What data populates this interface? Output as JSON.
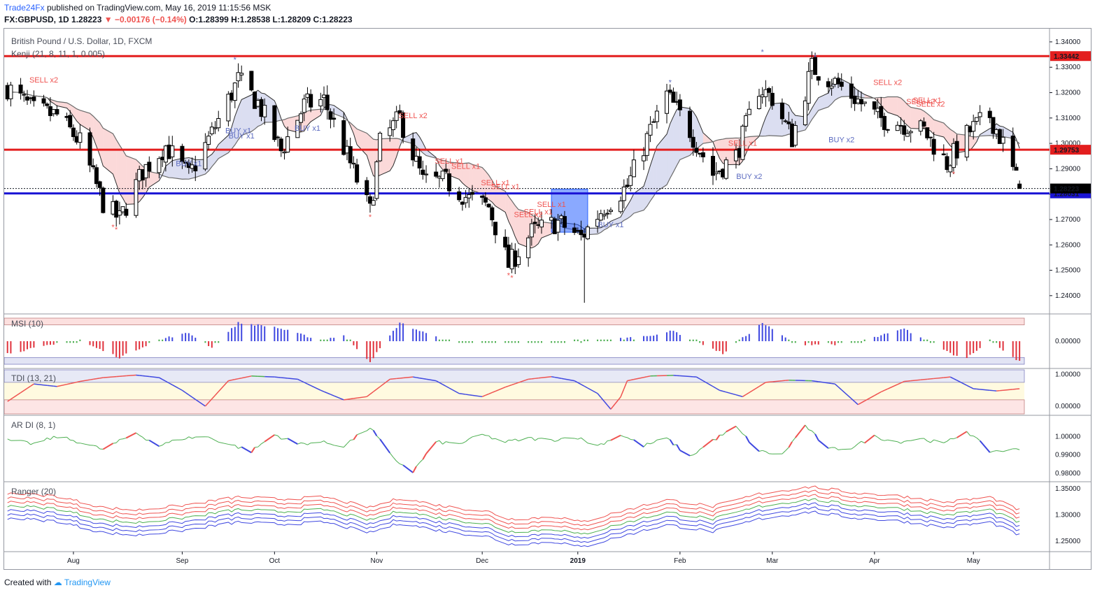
{
  "header": {
    "brand": "Trade24Fx",
    "published": "published on TradingView.com, May 16, 2019 11:15:56 MSK",
    "symbol": "FX:GBPUSD, 1D",
    "last": "1.28223",
    "change": "−0.00176 (−0.14%)",
    "ohlc": "O:1.28399 H:1.28538 L:1.28209 C:1.28223"
  },
  "footer": {
    "created": "Created with",
    "tv": "TradingView"
  },
  "colors": {
    "up": "#ffffff",
    "down": "#000000",
    "red_line": "#e31e1e",
    "blue_line": "#1a14d4",
    "sell": "#ef5350",
    "buy": "#5c6bc0",
    "msi_pos": "#3f48e0",
    "msi_neg": "#e0323c",
    "msi_flat": "#4caf50"
  },
  "chart_data": [
    {
      "type": "candlestick",
      "title": "British Pound / U.S. Dollar, 1D, FXCM",
      "indicator": "Kenji (21, 8, 11, 1, 0.005)",
      "ylim": [
        1.235,
        1.343
      ],
      "y_ticks": [
        "1.34000",
        "1.33000",
        "1.32000",
        "1.31000",
        "1.30000",
        "1.29000",
        "1.28000",
        "1.27000",
        "1.26000",
        "1.25000",
        "1.24000"
      ],
      "x_ticks": [
        "Aug",
        "Sep",
        "Oct",
        "Nov",
        "Dec",
        "2019",
        "Feb",
        "Mar",
        "Apr",
        "May"
      ],
      "horizontal_lines": [
        {
          "value": 1.3344,
          "label": "1.33442",
          "color": "red"
        },
        {
          "value": 1.2975,
          "label": "1.29753",
          "color": "red"
        },
        {
          "value": 1.2803,
          "label": "1.28031",
          "color": "blue"
        }
      ],
      "last_price": {
        "value": 1.28223,
        "label": "1.28223"
      },
      "close_path": [
        [
          "2018-07-12",
          1.322
        ],
        [
          "2018-07-20",
          1.313
        ],
        [
          "2018-07-27",
          1.311
        ],
        [
          "2018-08-03",
          1.3005
        ],
        [
          "2018-08-10",
          1.2765
        ],
        [
          "2018-08-15",
          1.27
        ],
        [
          "2018-08-22",
          1.289
        ],
        [
          "2018-08-29",
          1.299
        ],
        [
          "2018-09-05",
          1.287
        ],
        [
          "2018-09-12",
          1.304
        ],
        [
          "2018-09-20",
          1.325
        ],
        [
          "2018-09-26",
          1.316
        ],
        [
          "2018-10-03",
          1.297
        ],
        [
          "2018-10-10",
          1.315
        ],
        [
          "2018-10-16",
          1.317
        ],
        [
          "2018-10-24",
          1.292
        ],
        [
          "2018-10-30",
          1.273
        ],
        [
          "2018-11-02",
          1.3
        ],
        [
          "2018-11-08",
          1.31
        ],
        [
          "2018-11-15",
          1.285
        ],
        [
          "2018-11-22",
          1.285
        ],
        [
          "2018-11-29",
          1.278
        ],
        [
          "2018-12-05",
          1.275
        ],
        [
          "2018-12-11",
          1.252
        ],
        [
          "2018-12-18",
          1.265
        ],
        [
          "2018-12-26",
          1.269
        ],
        [
          "2019-01-02",
          1.263
        ],
        [
          "2019-01-09",
          1.275
        ],
        [
          "2019-01-16",
          1.283
        ],
        [
          "2019-01-23",
          1.305
        ],
        [
          "2019-01-28",
          1.319
        ],
        [
          "2019-02-04",
          1.305
        ],
        [
          "2019-02-11",
          1.288
        ],
        [
          "2019-02-18",
          1.295
        ],
        [
          "2019-02-25",
          1.322
        ],
        [
          "2019-03-01",
          1.318
        ],
        [
          "2019-03-07",
          1.302
        ],
        [
          "2019-03-13",
          1.33
        ],
        [
          "2019-03-20",
          1.324
        ],
        [
          "2019-03-26",
          1.318
        ],
        [
          "2019-04-02",
          1.31
        ],
        [
          "2019-04-09",
          1.308
        ],
        [
          "2019-04-16",
          1.305
        ],
        [
          "2019-04-23",
          1.292
        ],
        [
          "2019-04-30",
          1.305
        ],
        [
          "2019-05-06",
          1.311
        ],
        [
          "2019-05-10",
          1.3
        ],
        [
          "2019-05-15",
          1.2822
        ]
      ],
      "signals": [
        {
          "date": "2018-07-23",
          "text": "SELL x2",
          "side": "sell",
          "price": 1.324
        },
        {
          "date": "2018-09-05",
          "text": "BUY x1",
          "side": "buy",
          "price": 1.291
        },
        {
          "date": "2018-09-20",
          "text": "BUY x1",
          "side": "buy",
          "price": 1.304
        },
        {
          "date": "2018-09-21",
          "text": "BUY x1",
          "side": "buy",
          "price": 1.302
        },
        {
          "date": "2018-10-11",
          "text": "BUY x1",
          "side": "buy",
          "price": 1.305
        },
        {
          "date": "2018-11-12",
          "text": "SELL x2",
          "side": "sell",
          "price": 1.31
        },
        {
          "date": "2018-11-23",
          "text": "SELL x1",
          "side": "sell",
          "price": 1.292
        },
        {
          "date": "2018-11-28",
          "text": "SELL x1",
          "side": "sell",
          "price": 1.29
        },
        {
          "date": "2018-12-07",
          "text": "SELL x1",
          "side": "sell",
          "price": 1.2835
        },
        {
          "date": "2018-12-10",
          "text": "SELL x1",
          "side": "sell",
          "price": 1.282
        },
        {
          "date": "2018-12-17",
          "text": "SELL x2",
          "side": "sell",
          "price": 1.271
        },
        {
          "date": "2018-12-20",
          "text": "SELL x1",
          "side": "sell",
          "price": 1.272
        },
        {
          "date": "2018-12-24",
          "text": "SELL x1",
          "side": "sell",
          "price": 1.275
        },
        {
          "date": "2019-01-11",
          "text": "BUY x1",
          "side": "buy",
          "price": 1.267
        },
        {
          "date": "2019-02-20",
          "text": "SELL x1",
          "side": "sell",
          "price": 1.299
        },
        {
          "date": "2019-02-22",
          "text": "BUY x2",
          "side": "buy",
          "price": 1.286
        },
        {
          "date": "2019-03-22",
          "text": "BUY x2",
          "side": "buy",
          "price": 1.3005
        },
        {
          "date": "2019-04-05",
          "text": "SELL x2",
          "side": "sell",
          "price": 1.323
        },
        {
          "date": "2019-04-15",
          "text": "SELL x2",
          "side": "sell",
          "price": 1.3155
        },
        {
          "date": "2019-04-17",
          "text": "SELL x1",
          "side": "sell",
          "price": 1.316
        },
        {
          "date": "2019-04-18",
          "text": "SELL x2",
          "side": "sell",
          "price": 1.3145
        }
      ]
    },
    {
      "type": "bar",
      "title": "MSI (10)",
      "ylim": [
        -1.2,
        1.2
      ],
      "y_ticks": [
        "0.00000"
      ],
      "bands": [
        0.8,
        -0.8
      ]
    },
    {
      "type": "line",
      "title": "TDI (13, 21)",
      "ylim": [
        -0.2,
        1.1
      ],
      "y_ticks": [
        "1.00000",
        "0.00000"
      ],
      "bands": [
        0.75,
        0.2
      ],
      "points": [
        [
          "2018-07-12",
          0.15
        ],
        [
          "2018-07-20",
          0.7
        ],
        [
          "2018-07-27",
          0.62
        ],
        [
          "2018-08-03",
          0.78
        ],
        [
          "2018-08-10",
          0.9
        ],
        [
          "2018-08-20",
          0.98
        ],
        [
          "2018-08-27",
          0.9
        ],
        [
          "2018-09-03",
          0.5
        ],
        [
          "2018-09-10",
          0.0
        ],
        [
          "2018-09-17",
          0.8
        ],
        [
          "2018-09-24",
          0.95
        ],
        [
          "2018-10-01",
          0.92
        ],
        [
          "2018-10-08",
          0.85
        ],
        [
          "2018-10-15",
          0.5
        ],
        [
          "2018-10-22",
          0.2
        ],
        [
          "2018-10-29",
          0.3
        ],
        [
          "2018-11-05",
          0.85
        ],
        [
          "2018-11-12",
          0.92
        ],
        [
          "2018-11-19",
          0.8
        ],
        [
          "2018-11-26",
          0.4
        ],
        [
          "2018-12-03",
          0.3
        ],
        [
          "2018-12-10",
          0.6
        ],
        [
          "2018-12-17",
          0.85
        ],
        [
          "2018-12-24",
          0.93
        ],
        [
          "2018-12-31",
          0.8
        ],
        [
          "2019-01-07",
          0.4
        ],
        [
          "2019-01-12",
          -0.22
        ],
        [
          "2019-01-16",
          0.8
        ],
        [
          "2019-01-23",
          0.95
        ],
        [
          "2019-01-30",
          0.97
        ],
        [
          "2019-02-06",
          0.92
        ],
        [
          "2019-02-13",
          0.5
        ],
        [
          "2019-02-20",
          0.3
        ],
        [
          "2019-02-27",
          0.75
        ],
        [
          "2019-03-06",
          0.82
        ],
        [
          "2019-03-13",
          0.8
        ],
        [
          "2019-03-20",
          0.7
        ],
        [
          "2019-03-27",
          0.05
        ],
        [
          "2019-04-03",
          0.45
        ],
        [
          "2019-04-10",
          0.78
        ],
        [
          "2019-04-17",
          0.85
        ],
        [
          "2019-04-24",
          0.92
        ],
        [
          "2019-05-01",
          0.55
        ],
        [
          "2019-05-08",
          0.48
        ],
        [
          "2019-05-15",
          0.55
        ]
      ]
    },
    {
      "type": "line",
      "title": "AR DI (8, 1)",
      "ylim": [
        0.977,
        1.01
      ],
      "y_ticks": [
        "1.00000",
        "0.99000",
        "0.98000"
      ],
      "points": [
        [
          "2018-07-12",
          0.998
        ],
        [
          "2018-07-20",
          0.996
        ],
        [
          "2018-07-27",
          1.0
        ],
        [
          "2018-08-03",
          0.997
        ],
        [
          "2018-08-10",
          0.993
        ],
        [
          "2018-08-20",
          1.002
        ],
        [
          "2018-08-27",
          0.995
        ],
        [
          "2018-09-03",
          0.999
        ],
        [
          "2018-09-10",
          1.0
        ],
        [
          "2018-09-17",
          0.996
        ],
        [
          "2018-09-24",
          0.992
        ],
        [
          "2018-10-01",
          1.001
        ],
        [
          "2018-10-08",
          0.996
        ],
        [
          "2018-10-15",
          0.997
        ],
        [
          "2018-10-22",
          0.995
        ],
        [
          "2018-10-30",
          1.005
        ],
        [
          "2018-11-06",
          0.988
        ],
        [
          "2018-11-12",
          0.981
        ],
        [
          "2018-11-19",
          0.997
        ],
        [
          "2018-11-26",
          0.996
        ],
        [
          "2018-12-03",
          1.001
        ],
        [
          "2018-12-10",
          0.997
        ],
        [
          "2018-12-17",
          0.999
        ],
        [
          "2018-12-24",
          0.998
        ],
        [
          "2018-12-31",
          1.0
        ],
        [
          "2019-01-07",
          0.995
        ],
        [
          "2019-01-14",
          1.001
        ],
        [
          "2019-01-21",
          0.995
        ],
        [
          "2019-01-28",
          0.999
        ],
        [
          "2019-02-04",
          0.989
        ],
        [
          "2019-02-11",
          0.998
        ],
        [
          "2019-02-18",
          1.005
        ],
        [
          "2019-02-25",
          0.992
        ],
        [
          "2019-03-04",
          0.99
        ],
        [
          "2019-03-11",
          1.006
        ],
        [
          "2019-03-18",
          0.993
        ],
        [
          "2019-03-25",
          0.994
        ],
        [
          "2019-04-01",
          1.0
        ],
        [
          "2019-04-08",
          0.997
        ],
        [
          "2019-04-15",
          0.999
        ],
        [
          "2019-04-22",
          0.996
        ],
        [
          "2019-04-29",
          1.003
        ],
        [
          "2019-05-06",
          0.992
        ],
        [
          "2019-05-15",
          0.993
        ]
      ]
    },
    {
      "type": "line",
      "title": "Ranger (20)",
      "ylim": [
        1.235,
        1.358
      ],
      "y_ticks": [
        "1.35000",
        "1.30000",
        "1.25000"
      ],
      "center_path": [
        [
          "2018-07-12",
          1.318
        ],
        [
          "2018-07-27",
          1.312
        ],
        [
          "2018-08-10",
          1.29
        ],
        [
          "2018-08-20",
          1.285
        ],
        [
          "2018-09-03",
          1.294
        ],
        [
          "2018-09-20",
          1.31
        ],
        [
          "2018-10-03",
          1.306
        ],
        [
          "2018-10-16",
          1.31
        ],
        [
          "2018-10-30",
          1.29
        ],
        [
          "2018-11-08",
          1.308
        ],
        [
          "2018-11-22",
          1.292
        ],
        [
          "2018-12-05",
          1.282
        ],
        [
          "2018-12-11",
          1.268
        ],
        [
          "2018-12-26",
          1.272
        ],
        [
          "2019-01-02",
          1.262
        ],
        [
          "2019-01-16",
          1.286
        ],
        [
          "2019-01-28",
          1.305
        ],
        [
          "2019-02-11",
          1.292
        ],
        [
          "2019-02-25",
          1.316
        ],
        [
          "2019-03-13",
          1.33
        ],
        [
          "2019-03-26",
          1.318
        ],
        [
          "2019-04-09",
          1.312
        ],
        [
          "2019-04-23",
          1.3
        ],
        [
          "2019-05-06",
          1.31
        ],
        [
          "2019-05-15",
          1.285
        ]
      ]
    }
  ]
}
